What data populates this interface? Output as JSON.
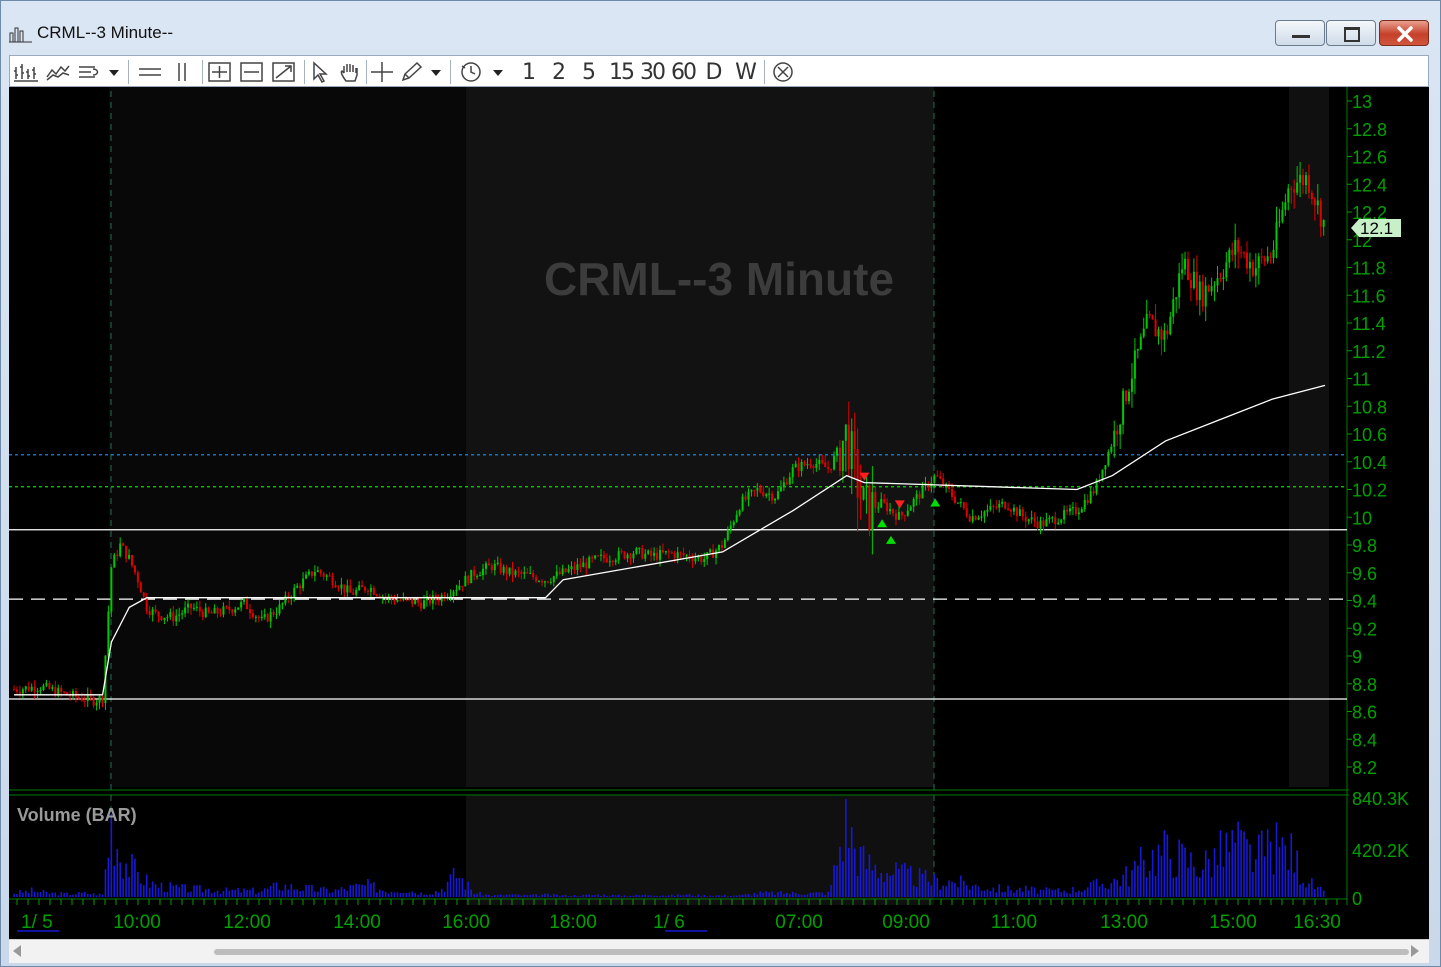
{
  "window": {
    "title": "CRML--3 Minute--"
  },
  "toolbar": {
    "icons": [
      "bar-chart-icon",
      "line-chart-icon",
      "indicator-list-icon",
      "horizontal-lines-icon",
      "vertical-lines-icon",
      "zoom-in-icon",
      "zoom-out-icon",
      "zoom-fit-icon",
      "pointer-icon",
      "hand-icon",
      "crosshair-icon",
      "pencil-icon",
      "clock-icon",
      "close-circle-icon"
    ],
    "intervals": [
      "1",
      "2",
      "5",
      "15",
      "30",
      "60",
      "D",
      "W"
    ]
  },
  "chart": {
    "watermark": "CRML--3 Minute",
    "current_price_label": "12.1",
    "volume_title": "Volume (BAR)",
    "price_ticks": [
      "13",
      "12.8",
      "12.6",
      "12.4",
      "12.2",
      "12",
      "11.8",
      "11.6",
      "11.4",
      "11.2",
      "11",
      "10.8",
      "10.6",
      "10.4",
      "10.2",
      "10",
      "9.8",
      "9.6",
      "9.4",
      "9.2",
      "9",
      "8.8",
      "8.6",
      "8.4",
      "8.2"
    ],
    "volume_ticks": [
      "840.3K",
      "420.2K",
      "0"
    ],
    "time_ticks": [
      "1/ 5",
      "10:00",
      "12:00",
      "14:00",
      "16:00",
      "18:00",
      "1/ 6",
      "07:00",
      "09:00",
      "11:00",
      "13:00",
      "15:00",
      "16:30"
    ],
    "colors": {
      "up": "#00c800",
      "down": "#e00000",
      "axis": "#00a000",
      "volume": "#1818d8",
      "blue_line": "#1e90ff",
      "green_line": "#00e000"
    }
  },
  "chart_data": {
    "type": "candlestick",
    "title": "CRML--3 Minute",
    "ylim": [
      8.1,
      13.1
    ],
    "horizontal_levels": [
      {
        "price": 10.45,
        "style": "dotted",
        "color": "#1e90ff"
      },
      {
        "price": 10.22,
        "style": "dotted",
        "color": "#00e000"
      },
      {
        "price": 9.91,
        "style": "solid",
        "color": "#ffffff"
      },
      {
        "price": 9.41,
        "style": "dashed",
        "color": "#ffffff"
      },
      {
        "price": 8.69,
        "style": "solid",
        "color": "#ffffff"
      }
    ],
    "price_path": [
      [
        0,
        8.76
      ],
      [
        3,
        8.78
      ],
      [
        6,
        8.72
      ],
      [
        9,
        8.68
      ],
      [
        10,
        8.7
      ],
      [
        11,
        9.65
      ],
      [
        12,
        9.8
      ],
      [
        13,
        9.7
      ],
      [
        14,
        9.55
      ],
      [
        15,
        9.35
      ],
      [
        16,
        9.3
      ],
      [
        18,
        9.28
      ],
      [
        20,
        9.35
      ],
      [
        22,
        9.3
      ],
      [
        24,
        9.33
      ],
      [
        26,
        9.38
      ],
      [
        28,
        9.25
      ],
      [
        30,
        9.35
      ],
      [
        32,
        9.5
      ],
      [
        34,
        9.62
      ],
      [
        36,
        9.55
      ],
      [
        38,
        9.45
      ],
      [
        40,
        9.5
      ],
      [
        42,
        9.42
      ],
      [
        44,
        9.4
      ],
      [
        46,
        9.38
      ],
      [
        48,
        9.42
      ],
      [
        50,
        9.5
      ],
      [
        52,
        9.6
      ],
      [
        54,
        9.65
      ],
      [
        56,
        9.6
      ],
      [
        58,
        9.58
      ],
      [
        60,
        9.55
      ],
      [
        62,
        9.6
      ],
      [
        64,
        9.65
      ],
      [
        66,
        9.7
      ],
      [
        68,
        9.72
      ],
      [
        70,
        9.75
      ],
      [
        72,
        9.72
      ],
      [
        74,
        9.74
      ],
      [
        76,
        9.72
      ],
      [
        78,
        9.7
      ],
      [
        80,
        9.8
      ],
      [
        82,
        10.1
      ],
      [
        84,
        10.2
      ],
      [
        86,
        10.15
      ],
      [
        88,
        10.35
      ],
      [
        90,
        10.4
      ],
      [
        92,
        10.35
      ],
      [
        94,
        10.6
      ],
      [
        95,
        10.3
      ],
      [
        96,
        10.05
      ],
      [
        98,
        10.1
      ],
      [
        100,
        10.0
      ],
      [
        102,
        10.15
      ],
      [
        104,
        10.3
      ],
      [
        106,
        10.15
      ],
      [
        108,
        10.0
      ],
      [
        110,
        10.05
      ],
      [
        112,
        10.1
      ],
      [
        114,
        10.0
      ],
      [
        116,
        9.95
      ],
      [
        118,
        10.0
      ],
      [
        120,
        10.05
      ],
      [
        122,
        10.2
      ],
      [
        124,
        10.55
      ],
      [
        126,
        11.0
      ],
      [
        128,
        11.4
      ],
      [
        130,
        11.3
      ],
      [
        132,
        11.85
      ],
      [
        134,
        11.6
      ],
      [
        136,
        11.75
      ],
      [
        138,
        11.95
      ],
      [
        140,
        11.8
      ],
      [
        142,
        11.9
      ],
      [
        144,
        12.4
      ],
      [
        146,
        12.45
      ],
      [
        148,
        12.1
      ]
    ],
    "vwap_path": [
      [
        0,
        8.72
      ],
      [
        10,
        8.72
      ],
      [
        11,
        9.1
      ],
      [
        13,
        9.35
      ],
      [
        15,
        9.42
      ],
      [
        40,
        9.42
      ],
      [
        60,
        9.42
      ],
      [
        62,
        9.55
      ],
      [
        80,
        9.75
      ],
      [
        84,
        9.9
      ],
      [
        88,
        10.05
      ],
      [
        94,
        10.3
      ],
      [
        96,
        10.25
      ],
      [
        120,
        10.2
      ],
      [
        124,
        10.3
      ],
      [
        130,
        10.55
      ],
      [
        136,
        10.7
      ],
      [
        142,
        10.85
      ],
      [
        148,
        10.95
      ]
    ],
    "volume_bars": [
      [
        0,
        0.05
      ],
      [
        2,
        0.08
      ],
      [
        4,
        0.05
      ],
      [
        6,
        0.04
      ],
      [
        8,
        0.05
      ],
      [
        10,
        0.03
      ],
      [
        11,
        1.0
      ],
      [
        12,
        0.55
      ],
      [
        13,
        0.4
      ],
      [
        14,
        0.3
      ],
      [
        15,
        0.2
      ],
      [
        16,
        0.15
      ],
      [
        18,
        0.12
      ],
      [
        20,
        0.1
      ],
      [
        22,
        0.1
      ],
      [
        24,
        0.08
      ],
      [
        26,
        0.08
      ],
      [
        28,
        0.08
      ],
      [
        30,
        0.15
      ],
      [
        32,
        0.12
      ],
      [
        34,
        0.1
      ],
      [
        36,
        0.08
      ],
      [
        38,
        0.12
      ],
      [
        40,
        0.15
      ],
      [
        42,
        0.08
      ],
      [
        44,
        0.1
      ],
      [
        46,
        0.05
      ],
      [
        48,
        0.08
      ],
      [
        50,
        0.3
      ],
      [
        52,
        0.05
      ],
      [
        54,
        0.02
      ],
      [
        56,
        0.03
      ],
      [
        58,
        0.02
      ],
      [
        60,
        0.03
      ],
      [
        62,
        0.02
      ],
      [
        64,
        0.02
      ],
      [
        66,
        0.03
      ],
      [
        68,
        0.02
      ],
      [
        70,
        0.02
      ],
      [
        72,
        0.03
      ],
      [
        74,
        0.02
      ],
      [
        76,
        0.03
      ],
      [
        78,
        0.02
      ],
      [
        80,
        0.02
      ],
      [
        82,
        0.02
      ],
      [
        84,
        0.05
      ],
      [
        86,
        0.05
      ],
      [
        88,
        0.05
      ],
      [
        90,
        0.05
      ],
      [
        92,
        0.05
      ],
      [
        94,
        1.0
      ],
      [
        95,
        0.6
      ],
      [
        96,
        0.45
      ],
      [
        98,
        0.35
      ],
      [
        100,
        0.3
      ],
      [
        102,
        0.25
      ],
      [
        104,
        0.2
      ],
      [
        106,
        0.2
      ],
      [
        108,
        0.15
      ],
      [
        110,
        0.12
      ],
      [
        112,
        0.1
      ],
      [
        114,
        0.1
      ],
      [
        116,
        0.08
      ],
      [
        118,
        0.08
      ],
      [
        120,
        0.1
      ],
      [
        122,
        0.15
      ],
      [
        124,
        0.2
      ],
      [
        126,
        0.3
      ],
      [
        128,
        0.5
      ],
      [
        130,
        0.6
      ],
      [
        132,
        0.5
      ],
      [
        134,
        0.4
      ],
      [
        136,
        0.55
      ],
      [
        138,
        0.7
      ],
      [
        140,
        0.5
      ],
      [
        142,
        0.65
      ],
      [
        144,
        0.6
      ],
      [
        146,
        0.2
      ],
      [
        148,
        0.05
      ]
    ],
    "signals": [
      {
        "i": 96,
        "price": 10.25,
        "dir": "down"
      },
      {
        "i": 98,
        "price": 10.0,
        "dir": "up"
      },
      {
        "i": 99,
        "price": 9.88,
        "dir": "up"
      },
      {
        "i": 100,
        "price": 10.05,
        "dir": "down"
      },
      {
        "i": 104,
        "price": 10.15,
        "dir": "up"
      }
    ]
  }
}
